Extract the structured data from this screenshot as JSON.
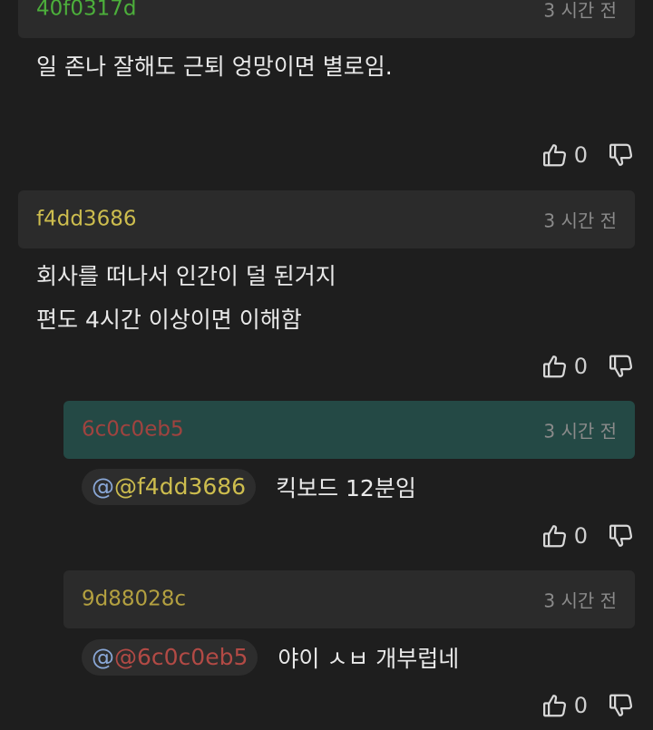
{
  "colors": {
    "background": "#1e1e1e",
    "header_bg": "#2b2b2b",
    "header_highlight_bg": "#244945",
    "time": "#8a8a8a",
    "text": "#e9e9e9"
  },
  "comments": [
    {
      "author": "40f0317d",
      "author_color": "#4caf3b",
      "time": "3 시간 전",
      "lines": [
        "일 존나 잘해도 근퇴 엉망이면 별로임."
      ],
      "likes": "0"
    },
    {
      "author": "f4dd3686",
      "author_color": "#cdbd4e",
      "time": "3 시간 전",
      "lines": [
        "회사를 떠나서 인간이 덜 된거지",
        "편도 4시간 이상이면 이해함"
      ],
      "likes": "0"
    },
    {
      "author": "6c0c0eb5",
      "author_color": "#a0433f",
      "time": "3 시간 전",
      "mention": "@f4dd3686",
      "mention_color": "#cdbd4e",
      "text": "킥보드 12분임",
      "likes": "0"
    },
    {
      "author": "9d88028c",
      "author_color": "#b3a040",
      "time": "3 시간 전",
      "mention": "@6c0c0eb5",
      "mention_color": "#b24a45",
      "text": "야이 ㅅㅂ 개부럽네",
      "likes": "0"
    }
  ]
}
